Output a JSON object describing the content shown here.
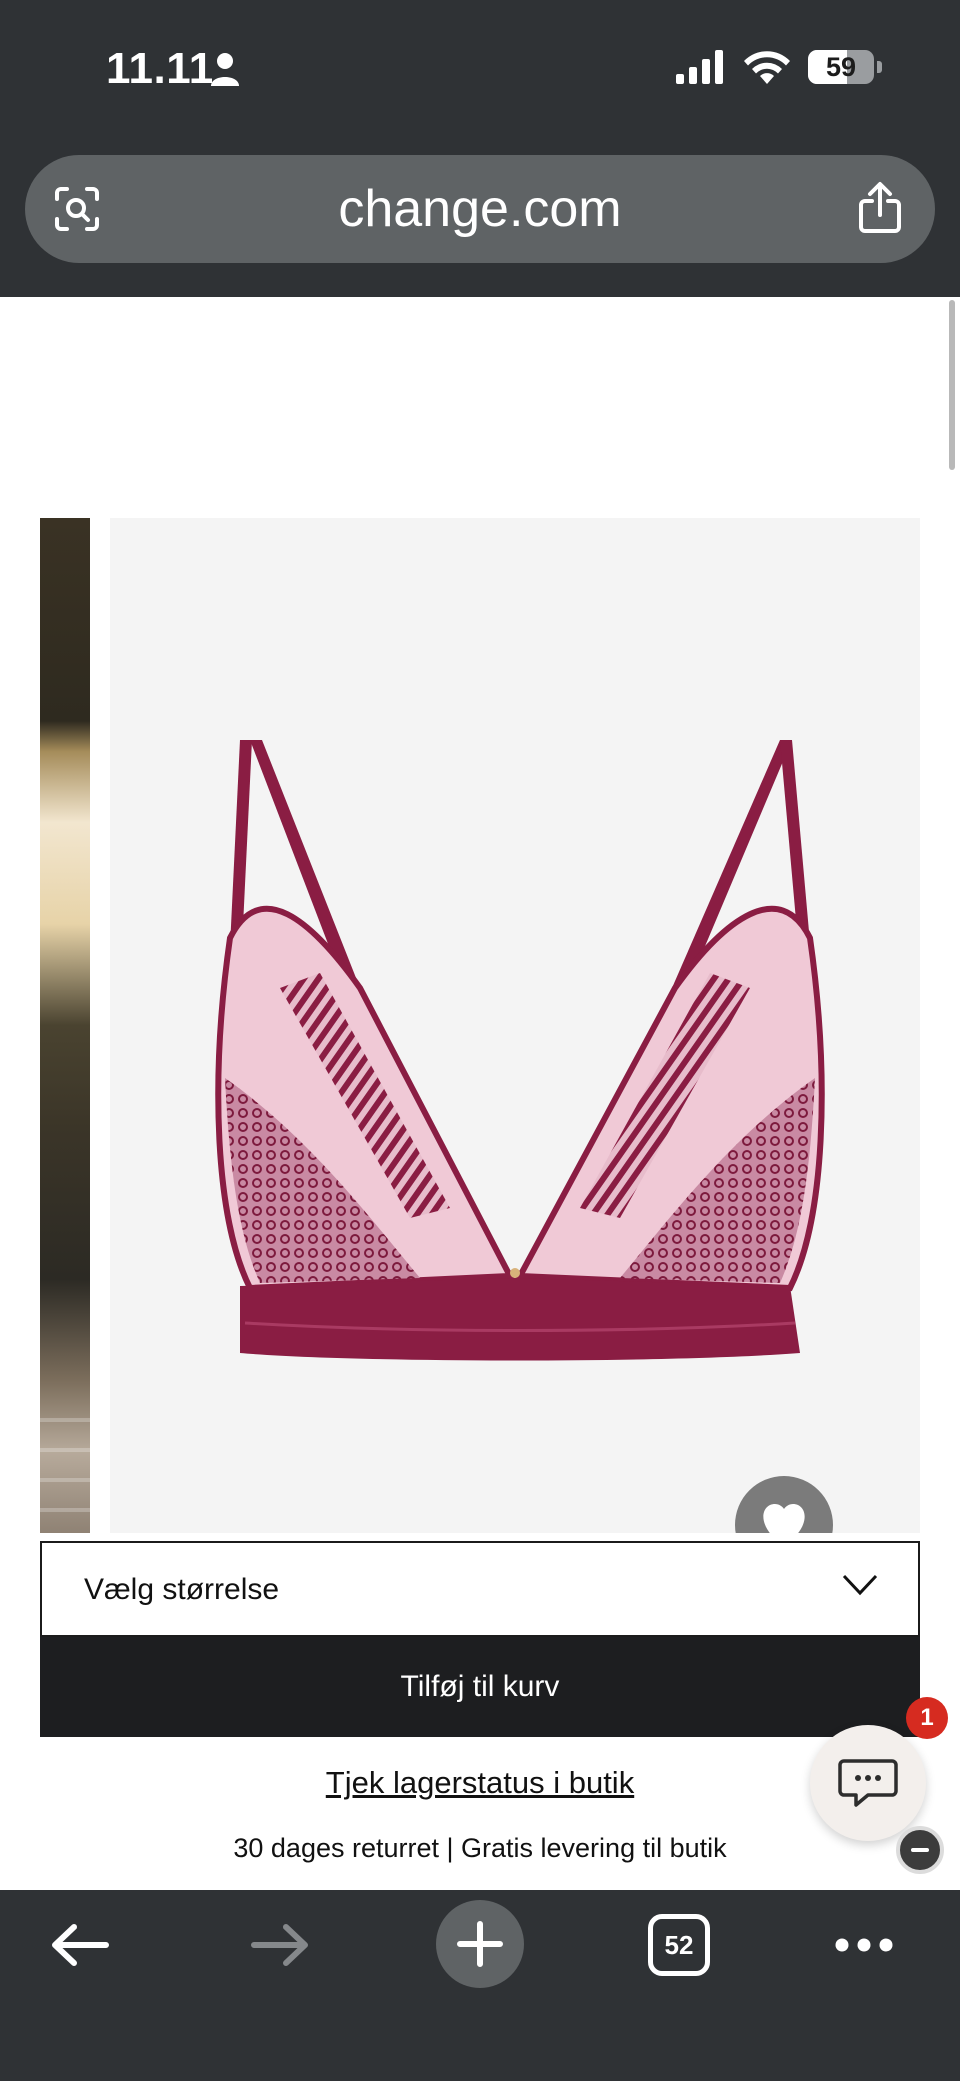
{
  "status_bar": {
    "time": "11.11",
    "battery": "59",
    "battery_level": 0.59
  },
  "browser": {
    "url": "change.com",
    "tab_count": "52"
  },
  "product": {
    "image_alt": "burgundy lace plunge bra",
    "size_select": {
      "placeholder": "Vælg størrelse"
    },
    "add_to_cart": "Tilføj til kurv",
    "stock_link": "Tjek lagerstatus i butik",
    "info": "30 dages returret | Gratis levering til butik"
  },
  "chat": {
    "badge": "1"
  },
  "colors": {
    "chrome": "#2f3235",
    "button_dark": "#1d1e20",
    "product_accent": "#8a1d43",
    "badge_red": "#d62b20"
  }
}
